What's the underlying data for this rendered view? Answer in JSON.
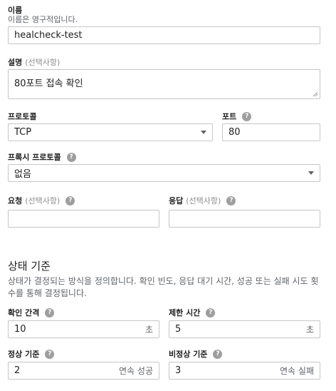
{
  "name": {
    "label": "이름",
    "hint": "이름은 영구적입니다.",
    "value": "healcheck-test"
  },
  "description": {
    "label": "설명",
    "optional": "(선택사항)",
    "value": "80포트 접속 확인"
  },
  "protocol": {
    "label": "프로토콜",
    "value": "TCP"
  },
  "port": {
    "label": "포트",
    "value": "80"
  },
  "proxy_protocol": {
    "label": "프록시 프로토콜",
    "value": "없음"
  },
  "request": {
    "label": "요청",
    "optional": "(선택사항)",
    "value": ""
  },
  "response": {
    "label": "응답",
    "optional": "(선택사항)",
    "value": ""
  },
  "health_criteria": {
    "title": "상태 기준",
    "description": "상태가 결정되는 방식을 정의합니다. 확인 빈도, 응답 대기 시간, 성공 또는 실패 시도 횟수를 통해 결정됩니다.",
    "check_interval": {
      "label": "확인 간격",
      "value": "10",
      "suffix": "초"
    },
    "timeout": {
      "label": "제한 시간",
      "value": "5",
      "suffix": "초"
    },
    "healthy_threshold": {
      "label": "정상 기준",
      "value": "2",
      "suffix": "연속 성공"
    },
    "unhealthy_threshold": {
      "label": "비정상 기준",
      "value": "3",
      "suffix": "연속 실패"
    }
  },
  "icons": {
    "help": "help-icon",
    "dropdown": "dropdown-caret-icon",
    "resize": "resize-handle-icon"
  },
  "colors": {
    "border": "#c6c6c6",
    "help_icon": "#9e9e9e",
    "muted_text": "#5f6368"
  }
}
